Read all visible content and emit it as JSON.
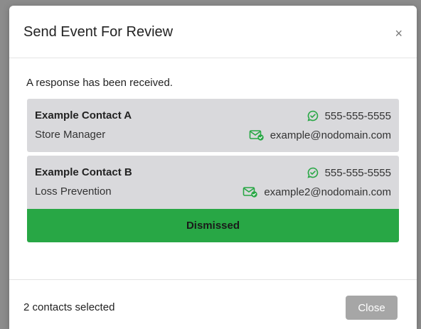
{
  "modal": {
    "title": "Send Event For Review",
    "close_symbol": "×"
  },
  "body": {
    "status_text": "A response has been received."
  },
  "contacts": [
    {
      "name": "Example Contact A",
      "role": "Store Manager",
      "phone": "555-555-5555",
      "email": "example@nodomain.com"
    },
    {
      "name": "Example Contact B",
      "role": "Loss Prevention",
      "phone": "555-555-5555",
      "email": "example2@nodomain.com"
    }
  ],
  "response": {
    "label": "Dismissed"
  },
  "footer": {
    "selection_text": "2 contacts selected",
    "close_label": "Close"
  },
  "colors": {
    "accent_green": "#28a745",
    "card_background": "#d9d9dc",
    "button_disabled": "#a6a6a6"
  },
  "icons": {
    "phone": "message-check-icon",
    "email": "email-check-icon"
  }
}
